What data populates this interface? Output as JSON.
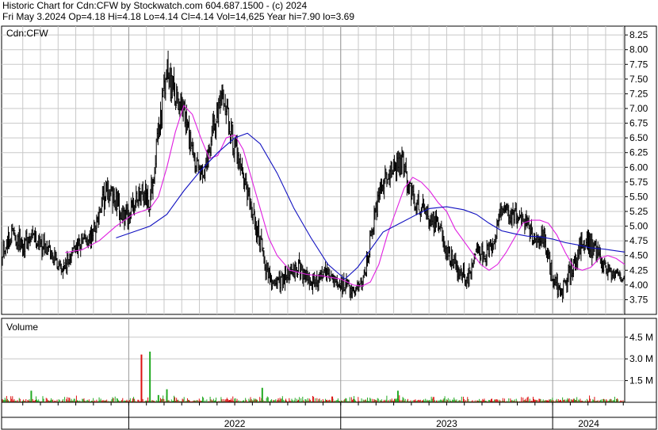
{
  "header": {
    "title_line": "Historic Chart for Cdn:CFW by Stockwatch.com 604.687.1500 - (c) 2024",
    "quote_line": "Fri May  3.2024  Op=4.18  Hi=4.18  Lo=4.14  Cl=4.14  Vol=14,625  Year hi=7.90  lo=3.69"
  },
  "colors": {
    "price_bar": "#000000",
    "short_ma": "#e020e0",
    "long_ma": "#1010c0",
    "volume_up": "#22aa22",
    "volume_down": "#dd1111",
    "grid": "#c8c8c8"
  },
  "chart_data": [
    {
      "type": "ohlc",
      "title": "Cdn:CFW",
      "y_axis_side": "right",
      "ylim": [
        3.5,
        8.4
      ],
      "y_ticks": [
        "8.25",
        "8.00",
        "7.75",
        "7.50",
        "7.25",
        "7.00",
        "6.75",
        "6.50",
        "6.25",
        "6.00",
        "5.75",
        "5.50",
        "5.25",
        "5.00",
        "4.75",
        "4.50",
        "4.25",
        "4.00",
        "3.75"
      ],
      "x_range": [
        2021.4,
        2024.34
      ],
      "x_tick_labels": [
        "2022",
        "2023",
        "2024"
      ],
      "year_boundaries": [
        2022.0,
        2023.0,
        2024.0
      ],
      "grid": true,
      "price_series": {
        "x": [
          2021.4,
          2021.45,
          2021.5,
          2021.55,
          2021.6,
          2021.63,
          2021.66,
          2021.7,
          2021.74,
          2021.78,
          2021.82,
          2021.86,
          2021.9,
          2021.94,
          2021.98,
          2022.02,
          2022.06,
          2022.1,
          2022.14,
          2022.18,
          2022.21,
          2022.24,
          2022.27,
          2022.3,
          2022.33,
          2022.36,
          2022.4,
          2022.44,
          2022.48,
          2022.52,
          2022.56,
          2022.6,
          2022.64,
          2022.68,
          2022.72,
          2022.76,
          2022.8,
          2022.83,
          2022.86,
          2022.9,
          2022.94,
          2022.98,
          2023.02,
          2023.06,
          2023.1,
          2023.12,
          2023.14,
          2023.17,
          2023.2,
          2023.23,
          2023.26,
          2023.29,
          2023.32,
          2023.35,
          2023.38,
          2023.4,
          2023.43,
          2023.46,
          2023.5,
          2023.53,
          2023.56,
          2023.6,
          2023.64,
          2023.68,
          2023.72,
          2023.76,
          2023.8,
          2023.84,
          2023.88,
          2023.92,
          2023.96,
          2024.0,
          2024.04,
          2024.08,
          2024.12,
          2024.16,
          2024.2,
          2024.24,
          2024.28,
          2024.32,
          2024.34
        ],
        "close": [
          4.6,
          4.9,
          4.7,
          4.8,
          4.65,
          4.55,
          4.4,
          4.3,
          4.6,
          4.75,
          4.8,
          5.2,
          5.6,
          5.4,
          5.1,
          5.3,
          5.6,
          5.4,
          6.6,
          7.6,
          7.3,
          7.1,
          6.8,
          6.2,
          5.9,
          6.0,
          6.7,
          7.1,
          6.7,
          6.0,
          5.5,
          5.0,
          4.4,
          4.0,
          4.1,
          4.2,
          4.3,
          4.2,
          4.0,
          4.1,
          4.2,
          4.0,
          4.0,
          3.9,
          4.0,
          4.3,
          4.8,
          5.3,
          5.7,
          5.9,
          6.0,
          6.1,
          5.7,
          5.4,
          5.3,
          5.25,
          5.1,
          5.0,
          4.6,
          4.4,
          4.2,
          4.1,
          4.6,
          4.5,
          4.7,
          5.3,
          5.2,
          5.2,
          5.0,
          4.8,
          4.8,
          4.1,
          3.85,
          4.2,
          4.6,
          4.75,
          4.55,
          4.3,
          4.2,
          4.15,
          4.14
        ],
        "range": [
          0.35,
          0.4,
          0.35,
          0.35,
          0.35,
          0.3,
          0.3,
          0.3,
          0.3,
          0.35,
          0.35,
          0.4,
          0.45,
          0.45,
          0.4,
          0.4,
          0.45,
          0.45,
          0.5,
          0.55,
          0.55,
          0.5,
          0.5,
          0.45,
          0.4,
          0.4,
          0.45,
          0.45,
          0.45,
          0.45,
          0.4,
          0.4,
          0.35,
          0.3,
          0.3,
          0.3,
          0.3,
          0.3,
          0.3,
          0.3,
          0.3,
          0.3,
          0.3,
          0.25,
          0.25,
          0.3,
          0.35,
          0.4,
          0.4,
          0.4,
          0.4,
          0.4,
          0.4,
          0.35,
          0.35,
          0.35,
          0.35,
          0.35,
          0.35,
          0.3,
          0.3,
          0.3,
          0.3,
          0.3,
          0.3,
          0.35,
          0.35,
          0.35,
          0.35,
          0.35,
          0.35,
          0.35,
          0.3,
          0.35,
          0.35,
          0.35,
          0.35,
          0.3,
          0.25,
          0.2,
          0.04
        ]
      },
      "moving_averages": [
        {
          "color_key": "short_ma",
          "x": [
            2021.7,
            2021.78,
            2021.86,
            2021.94,
            2022.02,
            2022.1,
            2022.14,
            2022.18,
            2022.22,
            2022.26,
            2022.3,
            2022.34,
            2022.38,
            2022.42,
            2022.46,
            2022.5,
            2022.54,
            2022.58,
            2022.62,
            2022.66,
            2022.7,
            2022.76,
            2022.84,
            2022.92,
            2023.0,
            2023.06,
            2023.1,
            2023.14,
            2023.18,
            2023.22,
            2023.26,
            2023.3,
            2023.34,
            2023.38,
            2023.42,
            2023.46,
            2023.5,
            2023.54,
            2023.58,
            2023.62,
            2023.66,
            2023.7,
            2023.74,
            2023.78,
            2023.82,
            2023.86,
            2023.9,
            2023.94,
            2023.98,
            2024.02,
            2024.06,
            2024.1,
            2024.14,
            2024.18,
            2024.22,
            2024.26,
            2024.3,
            2024.34
          ],
          "y": [
            4.55,
            4.6,
            4.75,
            5.0,
            5.2,
            5.3,
            5.5,
            6.0,
            6.6,
            7.05,
            6.9,
            6.5,
            6.15,
            6.2,
            6.5,
            6.55,
            6.3,
            5.8,
            5.3,
            4.8,
            4.5,
            4.25,
            4.18,
            4.15,
            4.1,
            4.0,
            3.98,
            4.05,
            4.35,
            4.85,
            5.25,
            5.65,
            5.83,
            5.75,
            5.6,
            5.4,
            5.25,
            4.95,
            4.75,
            4.55,
            4.35,
            4.25,
            4.35,
            4.55,
            4.8,
            5.05,
            5.1,
            5.1,
            5.05,
            4.85,
            4.55,
            4.3,
            4.25,
            4.3,
            4.45,
            4.5,
            4.45,
            4.35
          ]
        },
        {
          "color_key": "long_ma",
          "x": [
            2021.94,
            2022.02,
            2022.1,
            2022.18,
            2022.26,
            2022.34,
            2022.42,
            2022.5,
            2022.56,
            2022.62,
            2022.7,
            2022.78,
            2022.86,
            2022.94,
            2023.02,
            2023.08,
            2023.14,
            2023.2,
            2023.28,
            2023.36,
            2023.42,
            2023.5,
            2023.58,
            2023.64,
            2023.7,
            2023.76,
            2023.82,
            2023.88,
            2023.94,
            2024.0,
            2024.06,
            2024.12,
            2024.18,
            2024.24,
            2024.3,
            2024.34
          ],
          "y": [
            4.8,
            4.9,
            5.0,
            5.2,
            5.6,
            5.95,
            6.25,
            6.5,
            6.58,
            6.4,
            5.9,
            5.3,
            4.8,
            4.35,
            4.1,
            4.3,
            4.6,
            4.9,
            5.05,
            5.2,
            5.3,
            5.33,
            5.28,
            5.2,
            5.05,
            4.92,
            4.87,
            4.83,
            4.82,
            4.78,
            4.72,
            4.68,
            4.63,
            4.61,
            4.58,
            4.56
          ]
        }
      ]
    },
    {
      "type": "bar",
      "title": "Volume",
      "y_axis_side": "right",
      "ylim": [
        0,
        5.8
      ],
      "y_ticks": [
        "4.5 M",
        "3.0 M",
        "1.5 M"
      ],
      "spikes": [
        {
          "x": 2022.06,
          "value": 3.3,
          "direction": "down"
        },
        {
          "x": 2022.1,
          "value": 3.5,
          "direction": "up"
        },
        {
          "x": 2022.14,
          "value": 0.5,
          "direction": "up"
        },
        {
          "x": 2021.54,
          "value": 0.8,
          "direction": "up"
        },
        {
          "x": 2022.18,
          "value": 0.9,
          "direction": "up"
        },
        {
          "x": 2022.63,
          "value": 1.0,
          "direction": "up"
        },
        {
          "x": 2023.27,
          "value": 0.8,
          "direction": "up"
        },
        {
          "x": 2022.96,
          "value": 0.4,
          "direction": "down"
        }
      ]
    }
  ]
}
